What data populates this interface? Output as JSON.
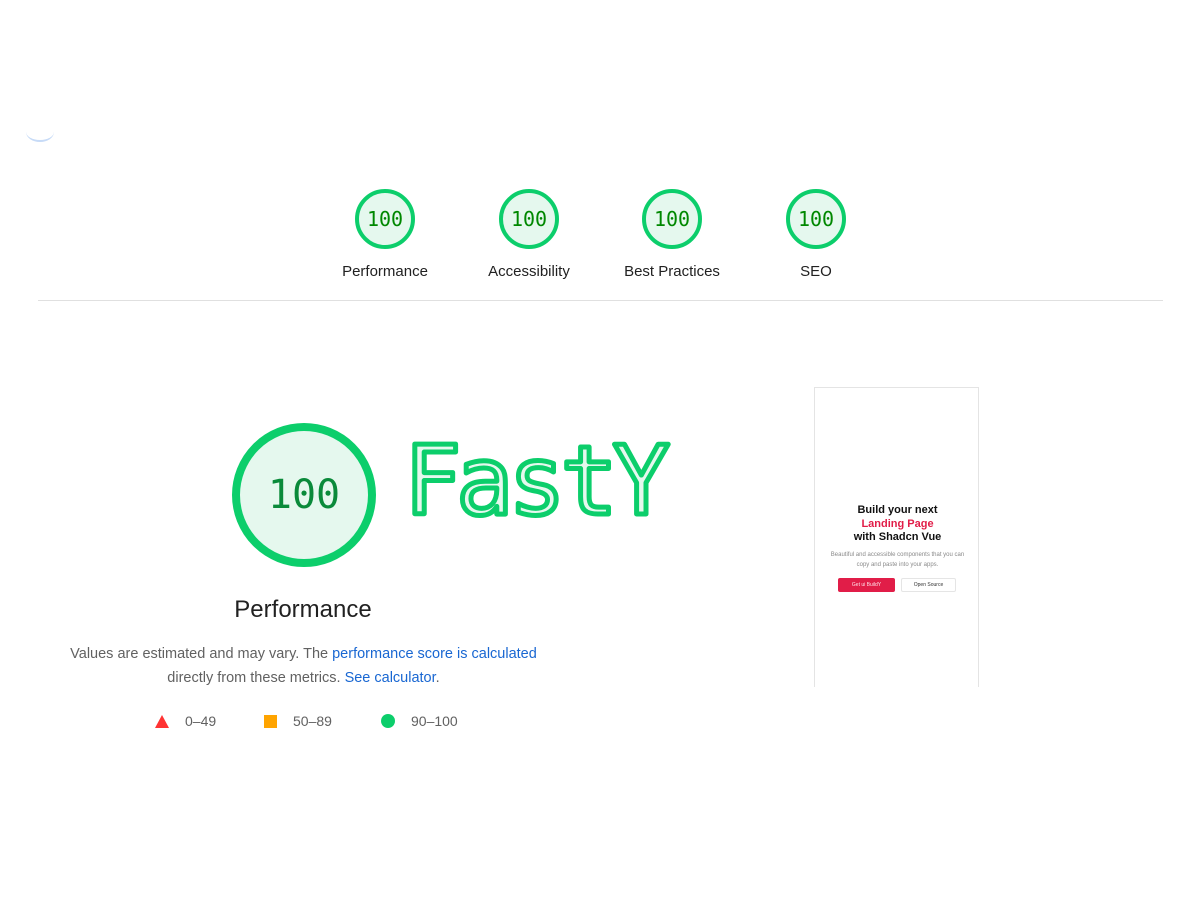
{
  "summary": [
    {
      "score": "100",
      "label": "Performance"
    },
    {
      "score": "100",
      "label": "Accessibility"
    },
    {
      "score": "100",
      "label": "Best Practices"
    },
    {
      "score": "100",
      "label": "SEO"
    }
  ],
  "performance": {
    "score": "100",
    "title": "Performance",
    "desc_text_1": "Values are estimated and may vary. The ",
    "desc_link_1": "performance score is calculated",
    "desc_text_2": "directly from these metrics. ",
    "desc_link_2": "See calculator",
    "desc_text_3": "."
  },
  "brand": {
    "logo_text": "FastY"
  },
  "legend": [
    {
      "icon": "triangle-icon",
      "range": "0–49",
      "color": "#ff3333"
    },
    {
      "icon": "square-icon",
      "range": "50–89",
      "color": "#ffa400"
    },
    {
      "icon": "circle-icon",
      "range": "90–100",
      "color": "#0cce6b"
    }
  ],
  "thumbnail": {
    "heading_line1": "Build your next",
    "heading_line2": "Landing Page",
    "heading_line3": "with Shadcn Vue",
    "paragraph": "Beautiful and accessible components that you can copy and paste into your apps.",
    "primary_button": "Get ui BuildY",
    "secondary_button": "Open Source"
  },
  "colors": {
    "pass": "#0cce6b",
    "pass_text": "#008800",
    "link": "#1967d2",
    "accent": "#e11d48"
  }
}
